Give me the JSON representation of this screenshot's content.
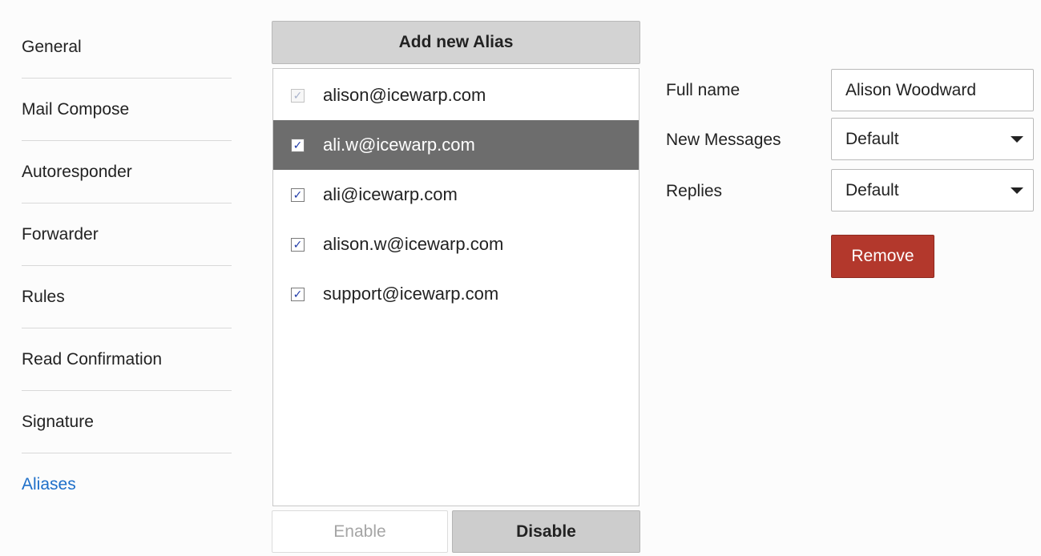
{
  "sidebar": {
    "items": [
      {
        "label": "General"
      },
      {
        "label": "Mail Compose"
      },
      {
        "label": "Autoresponder"
      },
      {
        "label": "Forwarder"
      },
      {
        "label": "Rules"
      },
      {
        "label": "Read Confirmation"
      },
      {
        "label": "Signature"
      },
      {
        "label": "Aliases",
        "active": true
      }
    ]
  },
  "aliases": {
    "add_label": "Add new Alias",
    "items": [
      {
        "email": "alison@icewarp.com",
        "checked": true,
        "disabled": true
      },
      {
        "email": "ali.w@icewarp.com",
        "checked": true,
        "selected": true
      },
      {
        "email": "ali@icewarp.com",
        "checked": true
      },
      {
        "email": "alison.w@icewarp.com",
        "checked": true
      },
      {
        "email": "support@icewarp.com",
        "checked": true
      }
    ],
    "enable_label": "Enable",
    "disable_label": "Disable"
  },
  "details": {
    "full_name_label": "Full name",
    "full_name_value": "Alison Woodward",
    "new_messages_label": "New Messages",
    "new_messages_value": "Default",
    "replies_label": "Replies",
    "replies_value": "Default",
    "remove_label": "Remove"
  },
  "colors": {
    "accent": "#1e6fc9",
    "selected_row": "#6d6d6d",
    "danger": "#b3382c"
  }
}
